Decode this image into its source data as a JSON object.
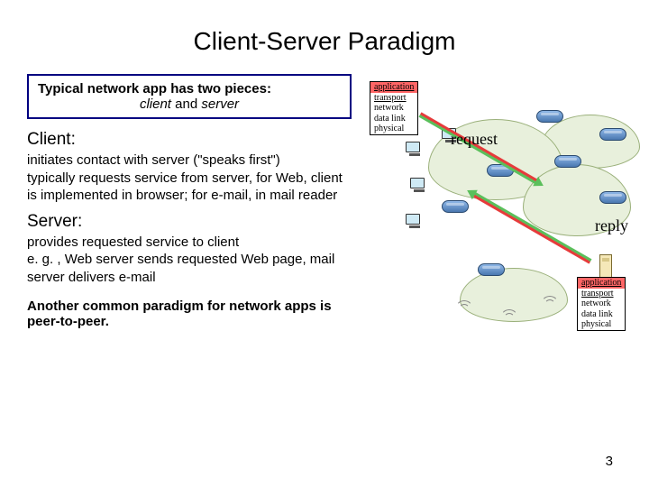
{
  "title": "Client-Server Paradigm",
  "box": {
    "line1": "Typical network app has two pieces:",
    "line2_prefix": "client",
    "line2_mid": " and ",
    "line2_suffix": "server"
  },
  "sections": {
    "client": {
      "heading": "Client:",
      "body": "initiates contact with server (\"speaks first\")\ntypically requests service from server, for Web, client is implemented in browser; for e-mail, in mail reader"
    },
    "server": {
      "heading": "Server:",
      "body": "provides requested service to client\ne. g. , Web server sends requested Web page, mail server delivers e-mail"
    },
    "footer": "Another common paradigm for network apps is peer-to-peer."
  },
  "labels": {
    "request": "request",
    "reply": "reply"
  },
  "stack": {
    "layers": [
      "application",
      "transport",
      "network",
      "data link",
      "physical"
    ]
  },
  "page_number": "3"
}
